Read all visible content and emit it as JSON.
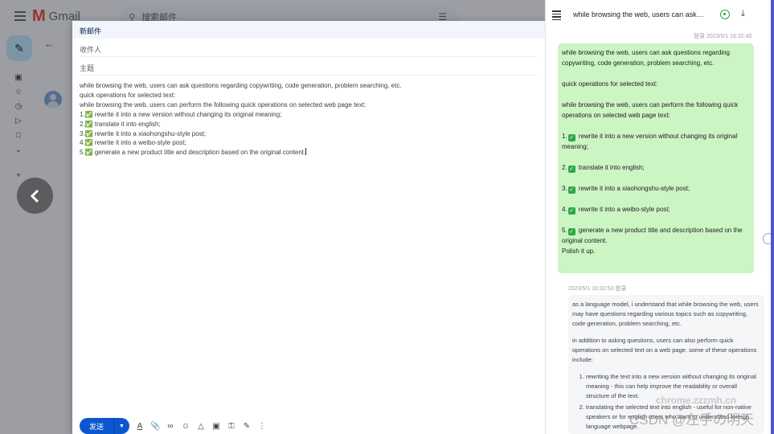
{
  "gmail": {
    "app_name": "Gmail",
    "search_placeholder": "搜索邮件"
  },
  "compose": {
    "header_title": "新邮件",
    "to_label": "收件人",
    "subject_label": "主题",
    "body_lines": [
      "while browsing the web, users can ask questions regarding copywriting, code generation, problem searching, etc.",
      "quick operations for selected text:",
      "while browsing the web, users can perform the following quick operations on selected web page text:",
      "1.✅ rewrite it into a new version without changing its original meaning;",
      "2.✅ translate it into english;",
      "3.✅ rewrite it into a xiaohongshu-style post;",
      "4.✅ rewrite it into a weibo-style post;",
      "5.✅ generate a new product title and description based on the original content."
    ],
    "send_label": "发送"
  },
  "chat": {
    "title": "while browsing the web, users can ask q...",
    "user_meta": "登录 2023/5/1 16:32:40",
    "user_message": {
      "p1": "while browsing the web, users can ask questions regarding copywriting, code generation, problem searching, etc.",
      "p2": "quick operations for selected text:",
      "p3": "while browsing the web, users can perform the following quick operations on selected web page text:",
      "item1": "rewrite it into a new version without changing its original meaning;",
      "item2": "translate it into english;",
      "item3": "rewrite it into a xiaohongshu-style post;",
      "item4": "rewrite it into a weibo-style post;",
      "item5": "generate a new product title and description based on the original content.",
      "closing": "Polish it up."
    },
    "bot_meta": "2023/5/1 16:32:53 登录",
    "bot_message": {
      "p1": "as a language model, i understand that while browsing the web, users may have questions regarding various topics such as copywriting, code generation, problem searching, etc.",
      "p2": "in addition to asking questions, users can also perform quick operations on selected text on a web page. some of these operations include:",
      "li1": "rewriting the text into a new version without changing its original meaning - this can help improve the readability or overall structure of the text.",
      "li2": "translating the selected text into english - useful for non-native speakers or for english users who want to understand foreign language webpage."
    }
  },
  "watermark": {
    "line1": "chrome.zzzmh.cn",
    "line2": "CSDN @左手の明天"
  },
  "colors": {
    "user_bubble": "#ccf5c4",
    "send_button": "#0b57d0",
    "check_green": "#2ea84a"
  }
}
